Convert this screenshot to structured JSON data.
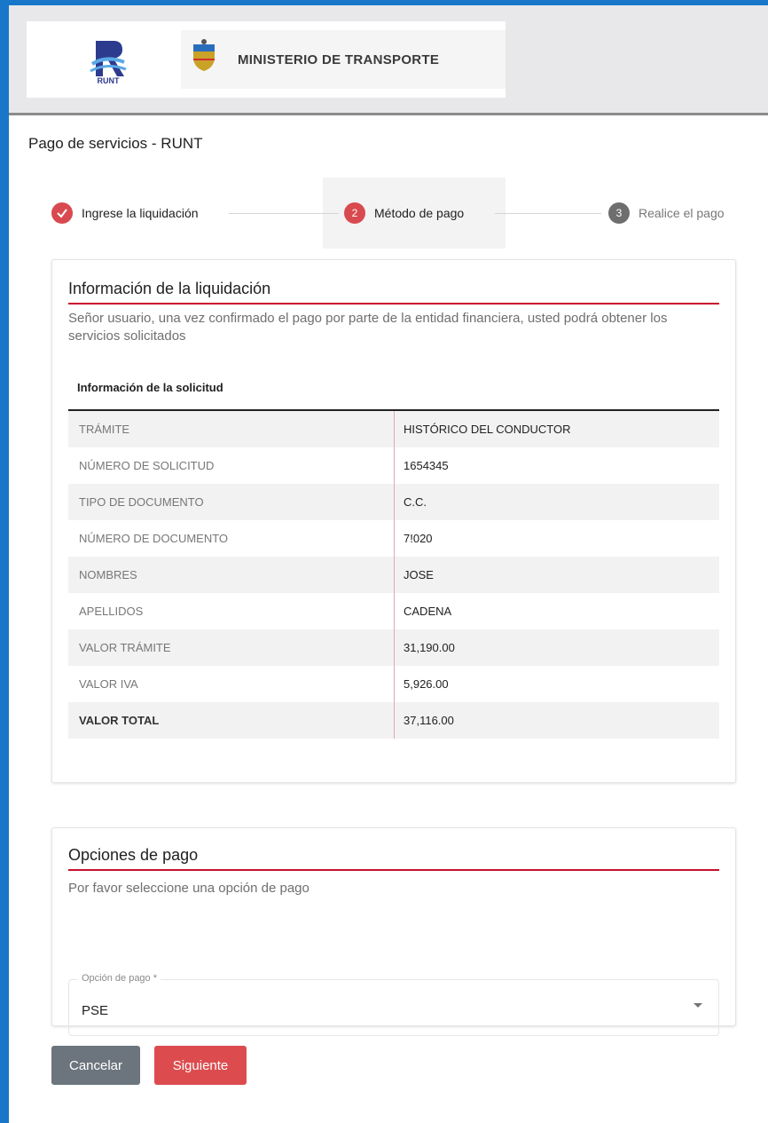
{
  "header": {
    "runt_logo_text": "RUNT",
    "ministry_name": "MINISTERIO DE TRANSPORTE"
  },
  "page": {
    "title": "Pago de servicios - RUNT"
  },
  "stepper": {
    "steps": [
      {
        "number": "1",
        "label": "Ingrese la liquidación",
        "state": "completed"
      },
      {
        "number": "2",
        "label": "Método de pago",
        "state": "active"
      },
      {
        "number": "3",
        "label": "Realice el pago",
        "state": "pending"
      }
    ]
  },
  "liquidacion": {
    "title": "Información de la liquidación",
    "description": "Señor usuario, una vez confirmado el pago por parte de la entidad financiera, usted podrá obtener los servicios solicitados",
    "table_title": "Información de la solicitud",
    "rows": [
      {
        "label": "TRÁMITE",
        "value": "HISTÓRICO DEL CONDUCTOR"
      },
      {
        "label": "NÚMERO DE SOLICITUD",
        "value": "1654345"
      },
      {
        "label": "TIPO DE DOCUMENTO",
        "value": "C.C."
      },
      {
        "label": "NÚMERO DE DOCUMENTO",
        "value": "7!020"
      },
      {
        "label": "NOMBRES",
        "value": "JOSE"
      },
      {
        "label": "APELLIDOS",
        "value": "CADENA"
      },
      {
        "label": "VALOR TRÁMITE",
        "value": "31,190.00"
      },
      {
        "label": "VALOR IVA",
        "value": "5,926.00"
      },
      {
        "label": "VALOR TOTAL",
        "value": "37,116.00"
      }
    ]
  },
  "opciones": {
    "title": "Opciones de pago",
    "description": "Por favor seleccione una opción de pago",
    "select_label": "Opción de pago *",
    "select_value": "PSE"
  },
  "buttons": {
    "cancel": "Cancelar",
    "next": "Siguiente"
  },
  "colors": {
    "accent_red": "#c8102e",
    "button_red": "#dc4c4f",
    "button_gray": "#6c757d",
    "frame_blue": "#1877c9"
  }
}
